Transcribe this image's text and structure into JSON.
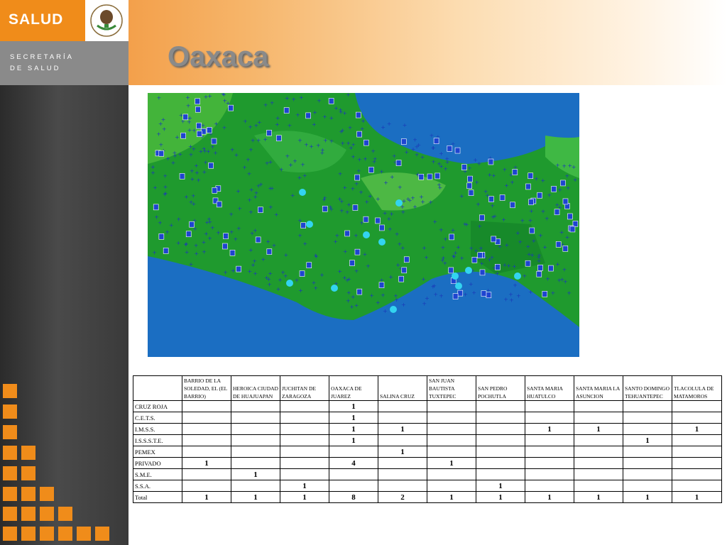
{
  "brand": {
    "name": "SALUD",
    "line1": "SECRETARÍA",
    "line2": "DE SALUD"
  },
  "slide": {
    "title": "Oaxaca"
  },
  "table": {
    "headers": [
      "",
      "BARRIO DE LA SOLEDAD, EL (EL BARRIO)",
      "HEROICA CIUDAD DE HUAJUAPAN",
      "JUCHITAN DE ZARAGOZA",
      "OAXACA DE JUAREZ",
      "SALINA CRUZ",
      "SAN JUAN BAUTISTA TUXTEPEC",
      "SAN PEDRO POCHUTLA",
      "SANTA MARIA HUATULCO",
      "SANTA MARIA LA ASUNCION",
      "SANTO DOMINGO TEHUANTEPEC",
      "TLACOLULA DE MATAMOROS"
    ],
    "rows": [
      {
        "label": "CRUZ ROJA",
        "values": [
          "",
          "",
          "",
          "1",
          "",
          "",
          "",
          "",
          "",
          "",
          ""
        ]
      },
      {
        "label": "C.E.T.S.",
        "values": [
          "",
          "",
          "",
          "1",
          "",
          "",
          "",
          "",
          "",
          "",
          ""
        ]
      },
      {
        "label": "I.M.S.S.",
        "values": [
          "",
          "",
          "",
          "1",
          "1",
          "",
          "",
          "1",
          "1",
          "",
          "1"
        ]
      },
      {
        "label": "I.S.S.S.T.E.",
        "values": [
          "",
          "",
          "",
          "1",
          "",
          "",
          "",
          "",
          "",
          "1",
          ""
        ]
      },
      {
        "label": "PEMEX",
        "values": [
          "",
          "",
          "",
          "",
          "1",
          "",
          "",
          "",
          "",
          "",
          ""
        ]
      },
      {
        "label": "PRIVADO",
        "values": [
          "1",
          "",
          "",
          "4",
          "",
          "1",
          "",
          "",
          "",
          "",
          ""
        ]
      },
      {
        "label": "S.M.E.",
        "values": [
          "",
          "1",
          "",
          "",
          "",
          "",
          "",
          "",
          "",
          "",
          ""
        ]
      },
      {
        "label": "S.S.A.",
        "values": [
          "",
          "",
          "1",
          "",
          "",
          "",
          "1",
          "",
          "",
          "",
          ""
        ]
      },
      {
        "label": "Total",
        "values": [
          "1",
          "1",
          "1",
          "8",
          "2",
          "1",
          "1",
          "1",
          "1",
          "1",
          "1"
        ]
      }
    ]
  }
}
